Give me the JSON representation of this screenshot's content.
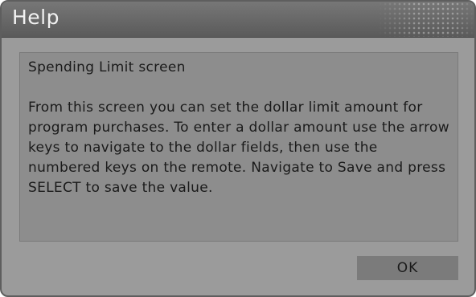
{
  "dialog": {
    "title": "Help",
    "heading": "Spending Limit screen",
    "body": "From this screen you can set the dollar limit amount for program purchases. To enter a dollar amount use the arrow keys to navigate to the dollar fields, then use the numbered keys on the remote.  Navigate to Save and press SELECT to save the value.",
    "ok_label": "OK"
  },
  "colors": {
    "dialog_background": "#9b9b9b",
    "title_bar": "#5a5a5a",
    "content_background": "#8d8d8d",
    "button_background": "#7b7b7b"
  }
}
